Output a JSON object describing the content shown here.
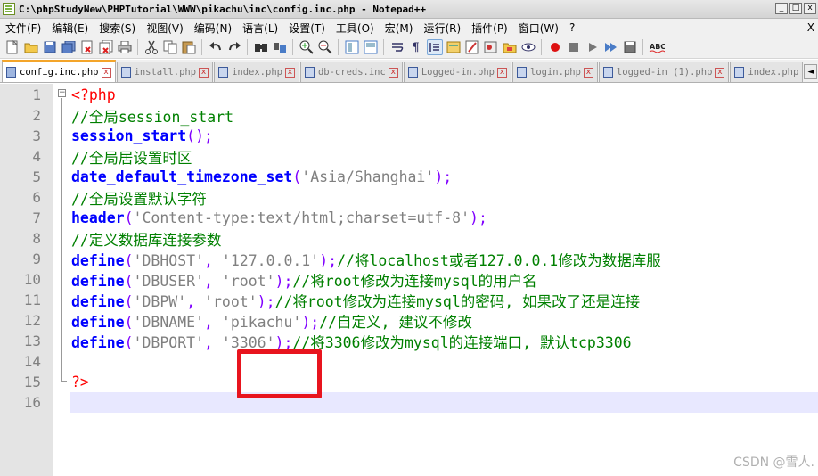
{
  "window": {
    "title": "C:\\phpStudyNew\\PHPTutorial\\WWW\\pikachu\\inc\\config.inc.php - Notepad++",
    "buttons": [
      "_",
      "□",
      "x"
    ]
  },
  "menu": {
    "items": [
      "文件(F)",
      "编辑(E)",
      "搜索(S)",
      "视图(V)",
      "编码(N)",
      "语言(L)",
      "设置(T)",
      "工具(O)",
      "宏(M)",
      "运行(R)",
      "插件(P)",
      "窗口(W)",
      "?"
    ],
    "close": "X"
  },
  "toolbar": {
    "icons": [
      "new-icon",
      "open-icon",
      "save-icon",
      "save-all-icon",
      "close-icon",
      "close-all-icon",
      "print-icon",
      "cut-icon",
      "copy-icon",
      "paste-icon",
      "undo-icon",
      "redo-icon",
      "find-icon",
      "replace-icon",
      "zoom-in-icon",
      "zoom-out-icon",
      "sync-v-icon",
      "sync-h-icon",
      "wrap-icon",
      "all-chars-icon",
      "indent-guide-icon",
      "udl-icon",
      "doc-map-icon",
      "function-list-icon",
      "folder-workspace-icon",
      "monitor-icon",
      "record-icon",
      "stop-icon",
      "play-icon",
      "play-multi-icon",
      "save-macro-icon",
      "spellcheck-icon"
    ]
  },
  "tabs": [
    {
      "label": "config.inc.php",
      "active": true
    },
    {
      "label": "install.php",
      "active": false
    },
    {
      "label": "index.php",
      "active": false
    },
    {
      "label": "db-creds.inc",
      "active": false
    },
    {
      "label": "Logged-in.php",
      "active": false
    },
    {
      "label": "login.php",
      "active": false
    },
    {
      "label": "logged-in (1).php",
      "active": false
    },
    {
      "label": "index.php",
      "active": false
    }
  ],
  "tab_nav": [
    "◄",
    "►",
    "x"
  ],
  "editor": {
    "fold_open": "−",
    "lines": [
      {
        "n": "1",
        "tokens": [
          {
            "t": "<?php",
            "c": "php"
          }
        ]
      },
      {
        "n": "2",
        "tokens": [
          {
            "t": "//全局session_start",
            "c": "cmt"
          }
        ]
      },
      {
        "n": "3",
        "tokens": [
          {
            "t": "session_start",
            "c": "kw"
          },
          {
            "t": "();",
            "c": "op"
          }
        ]
      },
      {
        "n": "4",
        "tokens": [
          {
            "t": "//全局居设置时区",
            "c": "cmt"
          }
        ]
      },
      {
        "n": "5",
        "tokens": [
          {
            "t": "date_default_timezone_set",
            "c": "kw"
          },
          {
            "t": "(",
            "c": "op"
          },
          {
            "t": "'Asia/Shanghai'",
            "c": "str"
          },
          {
            "t": ");",
            "c": "op"
          }
        ]
      },
      {
        "n": "6",
        "tokens": [
          {
            "t": "//全局设置默认字符",
            "c": "cmt"
          }
        ]
      },
      {
        "n": "7",
        "tokens": [
          {
            "t": "header",
            "c": "kw"
          },
          {
            "t": "(",
            "c": "op"
          },
          {
            "t": "'Content-type:text/html;charset=utf-8'",
            "c": "str"
          },
          {
            "t": ");",
            "c": "op"
          }
        ]
      },
      {
        "n": "8",
        "tokens": [
          {
            "t": "//定义数据库连接参数",
            "c": "cmt"
          }
        ]
      },
      {
        "n": "9",
        "tokens": [
          {
            "t": "define",
            "c": "kw"
          },
          {
            "t": "(",
            "c": "op"
          },
          {
            "t": "'DBHOST'",
            "c": "str"
          },
          {
            "t": ", ",
            "c": "op"
          },
          {
            "t": "'127.0.0.1'",
            "c": "str"
          },
          {
            "t": ");",
            "c": "op"
          },
          {
            "t": "//将localhost或者127.0.0.1修改为数据库服",
            "c": "cmt"
          }
        ]
      },
      {
        "n": "10",
        "tokens": [
          {
            "t": "define",
            "c": "kw"
          },
          {
            "t": "(",
            "c": "op"
          },
          {
            "t": "'DBUSER'",
            "c": "str"
          },
          {
            "t": ", ",
            "c": "op"
          },
          {
            "t": "'root'",
            "c": "str"
          },
          {
            "t": ");",
            "c": "op"
          },
          {
            "t": "//将root修改为连接mysql的用户名",
            "c": "cmt"
          }
        ]
      },
      {
        "n": "11",
        "tokens": [
          {
            "t": "define",
            "c": "kw"
          },
          {
            "t": "(",
            "c": "op"
          },
          {
            "t": "'DBPW'",
            "c": "str"
          },
          {
            "t": ", ",
            "c": "op"
          },
          {
            "t": "'root'",
            "c": "str"
          },
          {
            "t": ");",
            "c": "op"
          },
          {
            "t": "//将root修改为连接mysql的密码, 如果改了还是连接",
            "c": "cmt"
          }
        ]
      },
      {
        "n": "12",
        "tokens": [
          {
            "t": "define",
            "c": "kw"
          },
          {
            "t": "(",
            "c": "op"
          },
          {
            "t": "'DBNAME'",
            "c": "str"
          },
          {
            "t": ", ",
            "c": "op"
          },
          {
            "t": "'pikachu'",
            "c": "str"
          },
          {
            "t": ");",
            "c": "op"
          },
          {
            "t": "//自定义, 建议不修改",
            "c": "cmt"
          }
        ]
      },
      {
        "n": "13",
        "tokens": [
          {
            "t": "define",
            "c": "kw"
          },
          {
            "t": "(",
            "c": "op"
          },
          {
            "t": "'DBPORT'",
            "c": "str"
          },
          {
            "t": ", ",
            "c": "op"
          },
          {
            "t": "'3306'",
            "c": "str"
          },
          {
            "t": ");",
            "c": "op"
          },
          {
            "t": "//将3306修改为mysql的连接端口, 默认tcp3306",
            "c": "cmt"
          }
        ]
      },
      {
        "n": "14",
        "tokens": []
      },
      {
        "n": "15",
        "tokens": [
          {
            "t": "?>",
            "c": "php"
          }
        ]
      },
      {
        "n": "16",
        "tokens": []
      }
    ]
  },
  "watermark": "CSDN @雪人.",
  "colors": {
    "annotation": "#e8141e",
    "keyword": "#0000ff",
    "comment": "#008000",
    "string": "#808080",
    "operator": "#8000ff",
    "php_tag": "#ff0000"
  }
}
